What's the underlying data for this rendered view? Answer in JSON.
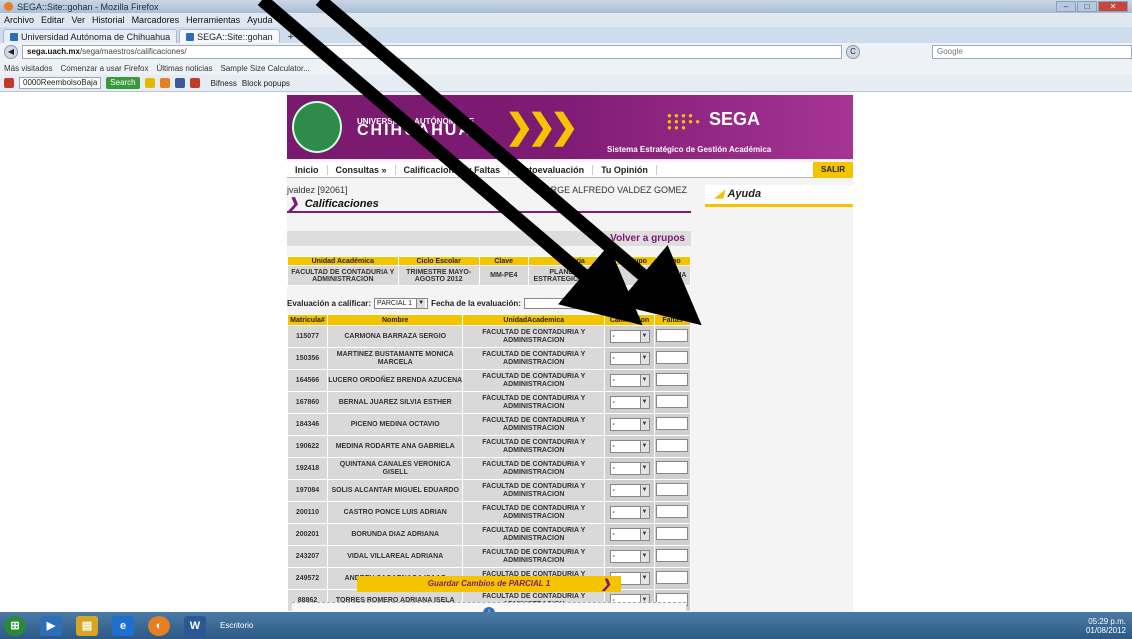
{
  "window": {
    "title": "SEGA::Site::gohan - Mozilla Firefox",
    "min": "–",
    "max": "□",
    "close": "✕"
  },
  "menu": [
    "Archivo",
    "Editar",
    "Ver",
    "Historial",
    "Marcadores",
    "Herramientas",
    "Ayuda"
  ],
  "tabs": [
    {
      "label": "Universidad Autónoma de Chihuahua"
    },
    {
      "label": "SEGA::Site::gohan"
    }
  ],
  "tab_new": "+",
  "nav": {
    "back": "◀",
    "reload": "C",
    "url_host": "sega.uach.mx",
    "url_path": "/sega/maestros/calificaciones/",
    "search_placeholder": "Google"
  },
  "bookmarks": [
    "Más visitados",
    "Comenzar a usar Firefox",
    "Últimas noticias",
    "Sample Size Calculator..."
  ],
  "addons": {
    "field": "0000ReembolsoBaja",
    "search_btn": "Search",
    "bifness": "Bifness",
    "block": "Block popups"
  },
  "site": {
    "uni_small": "UNIVERSIDAD AUTÓNOMA DE",
    "uni_big": "CHIHUAHUA",
    "chevrons": "❯❯❯",
    "sega": "SEGA",
    "sistema": "Sistema Estratégico de Gestión Académica",
    "nav": [
      "Inicio",
      "Consultas »",
      "Calificaciones y Faltas",
      "Autoevaluación",
      "Tu Opinión"
    ],
    "salir": "SALIR",
    "user_id": "jvaldez [92061]",
    "user_name": "JORGE ALFREDO VALDEZ GOMEZ",
    "page_title": "Calificaciones",
    "ayuda": "Ayuda",
    "volver": "Volver a grupos",
    "info_headers": [
      "Unidad Académica",
      "Ciclo Escolar",
      "Clave",
      "Materia",
      "Grupo",
      "Tipo"
    ],
    "info_values": [
      "FACULTAD DE CONTADURIA Y ADMINISTRACION",
      "TRIMESTRE MAYO-AGOSTO 2012",
      "MM-PE4",
      "PLANEACION ESTRATEGICA DE MKT",
      "",
      "TEORIA"
    ],
    "eval_label": "Evaluación a calificar:",
    "eval_value": "PARCIAL 1",
    "fecha_label": "Fecha de la evaluación:",
    "grid_headers": [
      "Matricula#",
      "Nombre",
      "UnidadAcademica",
      "Calificacion",
      "Faltas"
    ],
    "unidad": "FACULTAD DE CONTADURIA Y ADMINISTRACION",
    "cal_value": "-",
    "students": [
      {
        "m": "115077",
        "n": "CARMONA BARRAZA SERGIO"
      },
      {
        "m": "150356",
        "n": "MARTINEZ BUSTAMANTE MONICA MARCELA"
      },
      {
        "m": "164566",
        "n": "LUCERO ORDOÑEZ BRENDA AZUCENA"
      },
      {
        "m": "167860",
        "n": "BERNAL JUAREZ SILVIA ESTHER"
      },
      {
        "m": "184346",
        "n": "PICENO MEDINA OCTAVIO"
      },
      {
        "m": "190622",
        "n": "MEDINA RODARTE ANA GABRIELA"
      },
      {
        "m": "192418",
        "n": "QUINTANA CANALES VERONICA GISELL"
      },
      {
        "m": "197084",
        "n": "SOLIS ALCANTAR MIGUEL EDUARDO"
      },
      {
        "m": "200110",
        "n": "CASTRO PONCE LUIS ADRIAN"
      },
      {
        "m": "200201",
        "n": "BORUNDA DIAZ ADRIANA"
      },
      {
        "m": "243207",
        "n": "VIDAL VILLAREAL ADRIANA"
      },
      {
        "m": "249572",
        "n": "ANDREU SAGARNAGA ISAAC"
      },
      {
        "m": "88862",
        "n": "TORRES ROMERO ADRIANA ISELA"
      }
    ],
    "save": "Guardar Cambios de PARCIAL 1"
  },
  "taskbar": {
    "clock_time": "05:29 p.m.",
    "clock_date": "01/08/2012",
    "tray": "Escritorio"
  },
  "colors": {
    "brand": "#7d1a72",
    "accent": "#f5c400"
  }
}
